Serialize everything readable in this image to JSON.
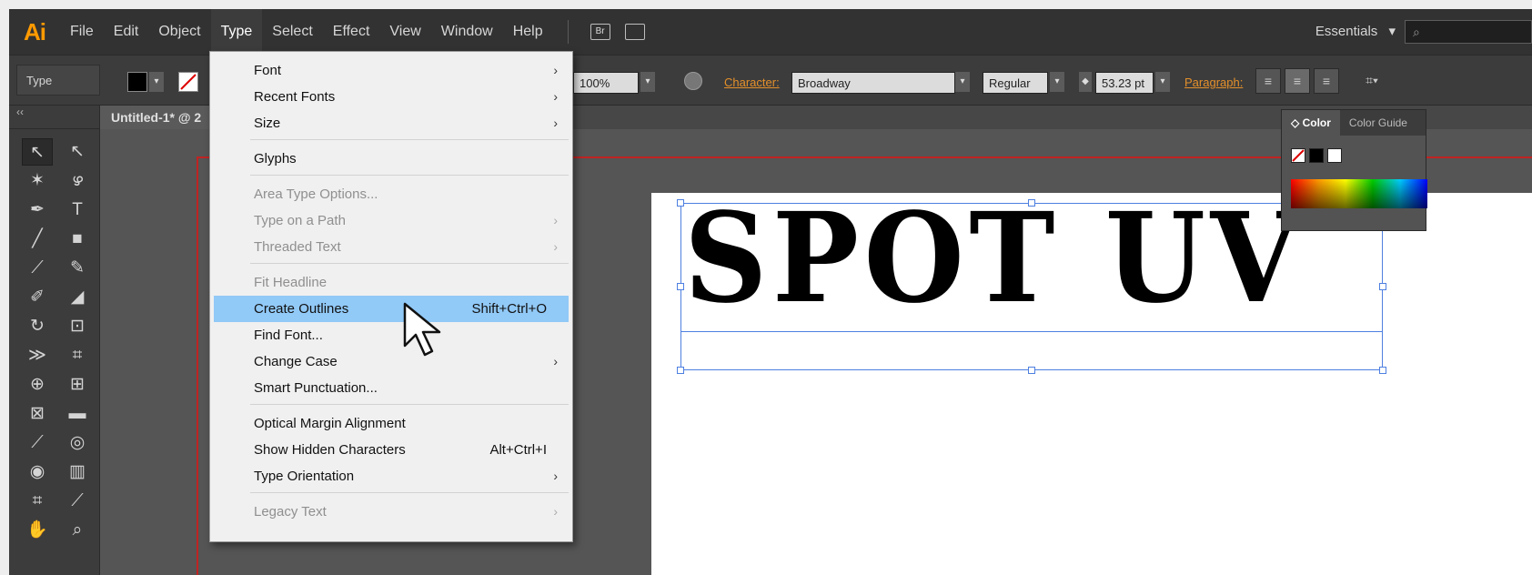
{
  "app": {
    "logo": "Ai",
    "menus": [
      "File",
      "Edit",
      "Object",
      "Type",
      "Select",
      "Effect",
      "View",
      "Window",
      "Help"
    ],
    "active_menu": "Type",
    "bridge_icon_label": "Br",
    "workspace": "Essentials",
    "workspace_arrow": "▾",
    "search_icon": "⌕"
  },
  "control_bar": {
    "label": "Type",
    "zoom": "100%",
    "character_link": "Character:",
    "font": "Broadway",
    "style": "Regular",
    "size": "53.23 pt",
    "paragraph_link": "Paragraph:"
  },
  "document": {
    "tab_title": "Untitled-1* @ 2"
  },
  "canvas": {
    "text": "SPOT UV"
  },
  "color_panel": {
    "tabs": [
      "Color",
      "Color Guide"
    ],
    "active_tab": "Color",
    "tab_prefix": "◇"
  },
  "type_menu": {
    "items": [
      {
        "label": "Font",
        "shortcut": "",
        "submenu": true,
        "disabled": false
      },
      {
        "label": "Recent Fonts",
        "shortcut": "",
        "submenu": true,
        "disabled": false
      },
      {
        "label": "Size",
        "shortcut": "",
        "submenu": true,
        "disabled": false
      },
      {
        "label": "Glyphs",
        "shortcut": "",
        "submenu": false,
        "disabled": false
      },
      {
        "label": "Area Type Options...",
        "shortcut": "",
        "submenu": false,
        "disabled": true
      },
      {
        "label": "Type on a Path",
        "shortcut": "",
        "submenu": true,
        "disabled": true
      },
      {
        "label": "Threaded Text",
        "shortcut": "",
        "submenu": true,
        "disabled": true
      },
      {
        "label": "Fit Headline",
        "shortcut": "",
        "submenu": false,
        "disabled": true
      },
      {
        "label": "Create Outlines",
        "shortcut": "Shift+Ctrl+O",
        "submenu": false,
        "disabled": false,
        "highlighted": true
      },
      {
        "label": "Find Font...",
        "shortcut": "",
        "submenu": false,
        "disabled": false
      },
      {
        "label": "Change Case",
        "shortcut": "",
        "submenu": true,
        "disabled": false
      },
      {
        "label": "Smart Punctuation...",
        "shortcut": "",
        "submenu": false,
        "disabled": false
      },
      {
        "label": "Optical Margin Alignment",
        "shortcut": "",
        "submenu": false,
        "disabled": false
      },
      {
        "label": "Show Hidden Characters",
        "shortcut": "Alt+Ctrl+I",
        "submenu": false,
        "disabled": false
      },
      {
        "label": "Type Orientation",
        "shortcut": "",
        "submenu": true,
        "disabled": false
      },
      {
        "label": "Legacy Text",
        "shortcut": "",
        "submenu": true,
        "disabled": true
      }
    ],
    "submenu_arrow": "›"
  },
  "colors": {
    "accent_orange": "#ff9a00",
    "menu_highlight": "#91c9f7",
    "bleed_red": "#c02323",
    "selection_blue": "#4d7fe0"
  }
}
